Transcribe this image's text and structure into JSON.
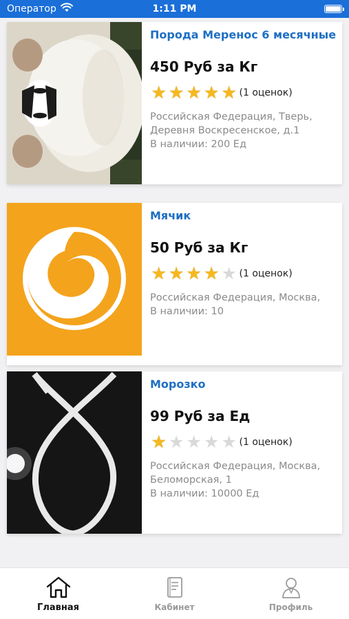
{
  "status_bar": {
    "carrier": "Оператор",
    "time": "1:11 PM"
  },
  "products": [
    {
      "title": "Порода Меренос 6 месячные",
      "price": "450 Руб за Кг",
      "rating": 5,
      "rating_count": "(1 оценок)",
      "address": "Российская Федерация, Тверь, Деревня Воскресенское, д.1",
      "stock": "В наличии: 200 Ед",
      "image": "sheep-photo"
    },
    {
      "title": "Мячик",
      "price": "50 Руб за Кг",
      "rating": 4,
      "rating_count": "(1 оценок)",
      "address": "Российская Федерация, Москва,",
      "stock": "В наличии: 10",
      "image": "orange-swirl-logo"
    },
    {
      "title": "Морозко",
      "price": "99 Руб за Ед",
      "rating": 1,
      "rating_count": "(1 оценок)",
      "address": "Российская Федерация, Москва, Беломорская, 1",
      "stock": "В наличии: 10000 Ед",
      "image": "fish-symbol-photo"
    }
  ],
  "tab_bar": {
    "tabs": [
      {
        "label": "Главная",
        "icon": "home-icon",
        "active": true
      },
      {
        "label": "Кабинет",
        "icon": "document-icon",
        "active": false
      },
      {
        "label": "Профиль",
        "icon": "user-icon",
        "active": false
      }
    ]
  },
  "colors": {
    "status_bar": "#1a6fd8",
    "title": "#1e6fc3",
    "star_on": "#f5b81f",
    "star_off": "#d9d9d9"
  }
}
